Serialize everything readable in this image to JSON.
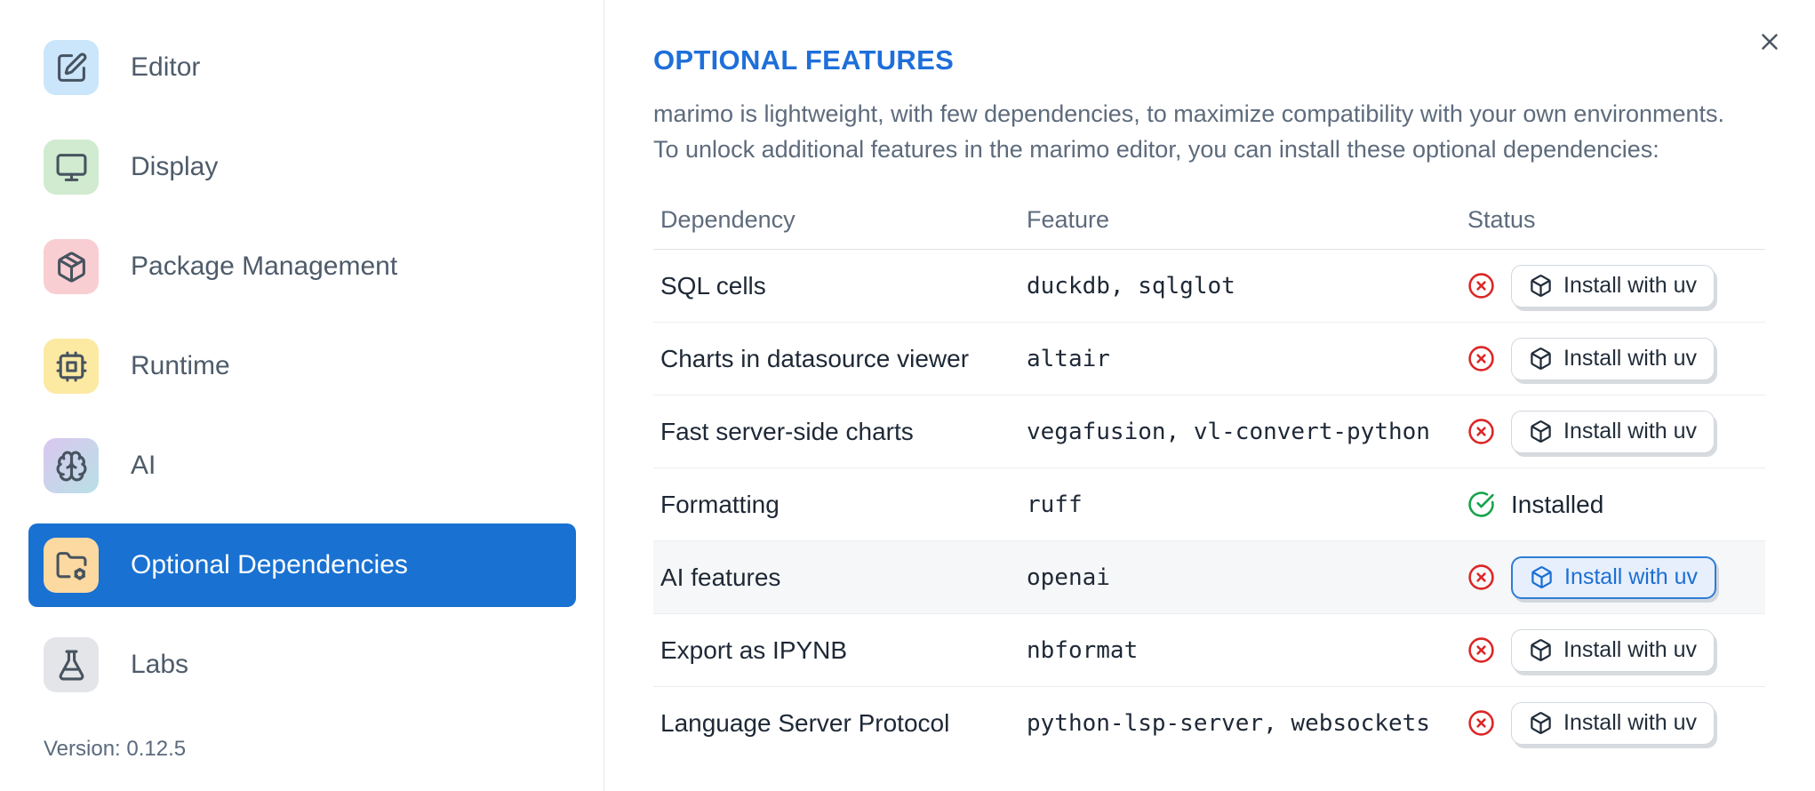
{
  "sidebar": {
    "items": [
      {
        "label": "Editor",
        "icon": "square-pen-icon",
        "icon_key": "square-pen",
        "icon_bg": "#cbe6fa"
      },
      {
        "label": "Display",
        "icon": "monitor-icon",
        "icon_key": "monitor",
        "icon_bg": "#d0ebd0"
      },
      {
        "label": "Package Management",
        "icon": "package-icon",
        "icon_key": "package",
        "icon_bg": "#f9ced2"
      },
      {
        "label": "Runtime",
        "icon": "cpu-icon",
        "icon_key": "cpu",
        "icon_bg": "#fce9a2"
      },
      {
        "label": "AI",
        "icon": "brain-icon",
        "icon_key": "brain",
        "icon_bg": "#dac7ef",
        "icon_bg2": "#b9e0e6"
      },
      {
        "label": "Optional Dependencies",
        "icon": "folder-cog-icon",
        "icon_key": "folder-cog",
        "icon_bg": "#fcd9a0",
        "selected": true
      },
      {
        "label": "Labs",
        "icon": "flask-icon",
        "icon_key": "flask",
        "icon_bg": "#e4e5e8"
      }
    ],
    "version_label": "Version: 0.12.5"
  },
  "dialog": {
    "title": "OPTIONAL FEATURES",
    "description": [
      "marimo is lightweight, with few dependencies, to maximize compatibility with your own environments.",
      "To unlock additional features in the marimo editor, you can install these optional dependencies:"
    ],
    "close_icon": "x-icon"
  },
  "table": {
    "columns": [
      "Dependency",
      "Feature",
      "Status"
    ],
    "rows": [
      {
        "dependency": "SQL cells",
        "feature": "duckdb, sqlglot",
        "installed": false,
        "action_label": "Install with uv"
      },
      {
        "dependency": "Charts in datasource viewer",
        "feature": "altair",
        "installed": false,
        "action_label": "Install with uv"
      },
      {
        "dependency": "Fast server-side charts",
        "feature": "vegafusion, vl-convert-python",
        "installed": false,
        "action_label": "Install with uv"
      },
      {
        "dependency": "Formatting",
        "feature": "ruff",
        "installed": true,
        "status_label": "Installed"
      },
      {
        "dependency": "AI features",
        "feature": "openai",
        "installed": false,
        "action_label": "Install with uv",
        "highlighted": true
      },
      {
        "dependency": "Export as IPYNB",
        "feature": "nbformat",
        "installed": false,
        "action_label": "Install with uv"
      },
      {
        "dependency": "Language Server Protocol",
        "feature": "python-lsp-server, websockets",
        "installed": false,
        "action_label": "Install with uv"
      }
    ]
  },
  "colors": {
    "selected-item-bg": "#1971d2",
    "title-blue": "#1e6fd9",
    "status-red": "#dc2626",
    "status-green": "#16a34a",
    "focus-border": "#2e7cd6",
    "focus-bg": "#e7effc",
    "focus-text": "#1b6fd3"
  }
}
